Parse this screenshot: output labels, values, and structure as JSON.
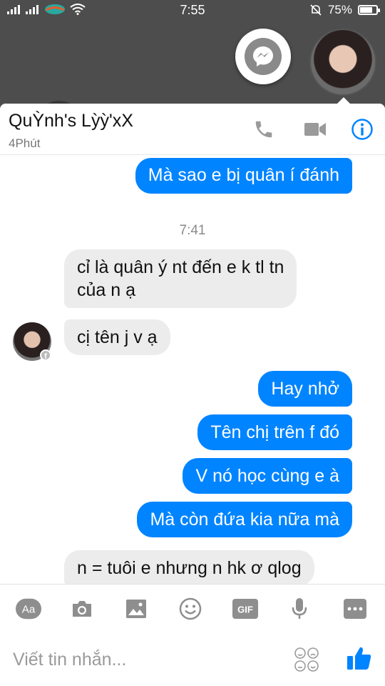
{
  "status_bar": {
    "time": "7:55",
    "battery": "75%",
    "icons": [
      "signal-icon",
      "signal-icon",
      "carrier-icon",
      "wifi-icon",
      "silent-bell-icon",
      "battery-icon"
    ]
  },
  "chat_heads": {
    "messenger_icon": "messenger-icon",
    "avatar": "contact-avatar"
  },
  "header": {
    "name": "QuỲnh's Lỳỳ'xX",
    "status": "4Phút",
    "icons": [
      "phone-icon",
      "video-icon",
      "info-icon"
    ]
  },
  "conversation": {
    "messages": [
      {
        "side": "out",
        "text": "Mà sao e bị quân í đánh"
      },
      {
        "timestamp": "7:41"
      },
      {
        "side": "in",
        "lines": [
          "cỉ là quân ý nt đến e k tl tn",
          "của n ạ"
        ]
      },
      {
        "side": "in",
        "text": "cị tên j v ạ"
      },
      {
        "side": "out",
        "text": "Hay nhở"
      },
      {
        "side": "out",
        "text": "Tên chị trên f đó"
      },
      {
        "side": "out",
        "text": "V nó học cùng e à"
      },
      {
        "side": "out",
        "text": "Mà còn đứa kia nữa mà"
      },
      {
        "side": "in",
        "text": "n = tuôi e nhưng n hk ơ qlog"
      }
    ],
    "m0": "Mà sao e bị quân í đánh",
    "ts": "7:41",
    "m1_line1": "cỉ là quân ý nt đến e k tl tn",
    "m1_line2": "của n ạ",
    "m2": "cị tên j v ạ",
    "m3": "Hay nhở",
    "m4": "Tên chị trên f đó",
    "m5": "V nó học cùng e à",
    "m6": "Mà còn đứa kia nữa mà",
    "m7": "n = tuôi e nhưng n hk ơ qlog"
  },
  "toolbar": {
    "aa_label": "Aa",
    "gif_label": "GIF",
    "icons": [
      "text-format-icon",
      "camera-icon",
      "image-icon",
      "emoji-icon",
      "gif-icon",
      "microphone-icon",
      "more-icon"
    ]
  },
  "composer": {
    "placeholder": "Viết tin nhắn...",
    "icons": [
      "emoji-face-icon",
      "thumbs-up-icon"
    ]
  },
  "colors": {
    "accent": "#0084ff",
    "incoming_bubble": "#ececec",
    "background_dim": "#4d4d4d"
  }
}
